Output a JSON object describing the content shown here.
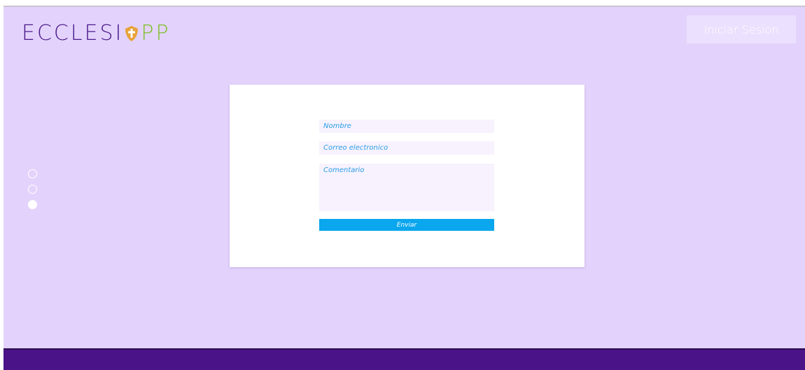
{
  "header": {
    "logo_main": "ECCLESI",
    "logo_tail": "PP",
    "logo_icon": "cross-shield-icon",
    "login_label": "Iniciar Sesion"
  },
  "slider": {
    "dots": [
      {
        "active": false
      },
      {
        "active": false
      },
      {
        "active": true
      }
    ]
  },
  "contact_form": {
    "name_placeholder": "Nombre",
    "email_placeholder": "Correo electronico",
    "comment_placeholder": "Comentario",
    "submit_label": "Enviar"
  },
  "colors": {
    "background": "#e3d3fc",
    "brand_purple": "#4b1388",
    "accent_blue": "#0aa6ee",
    "logo_green": "#7fbf2a",
    "logo_gold": "#e8a23a"
  }
}
